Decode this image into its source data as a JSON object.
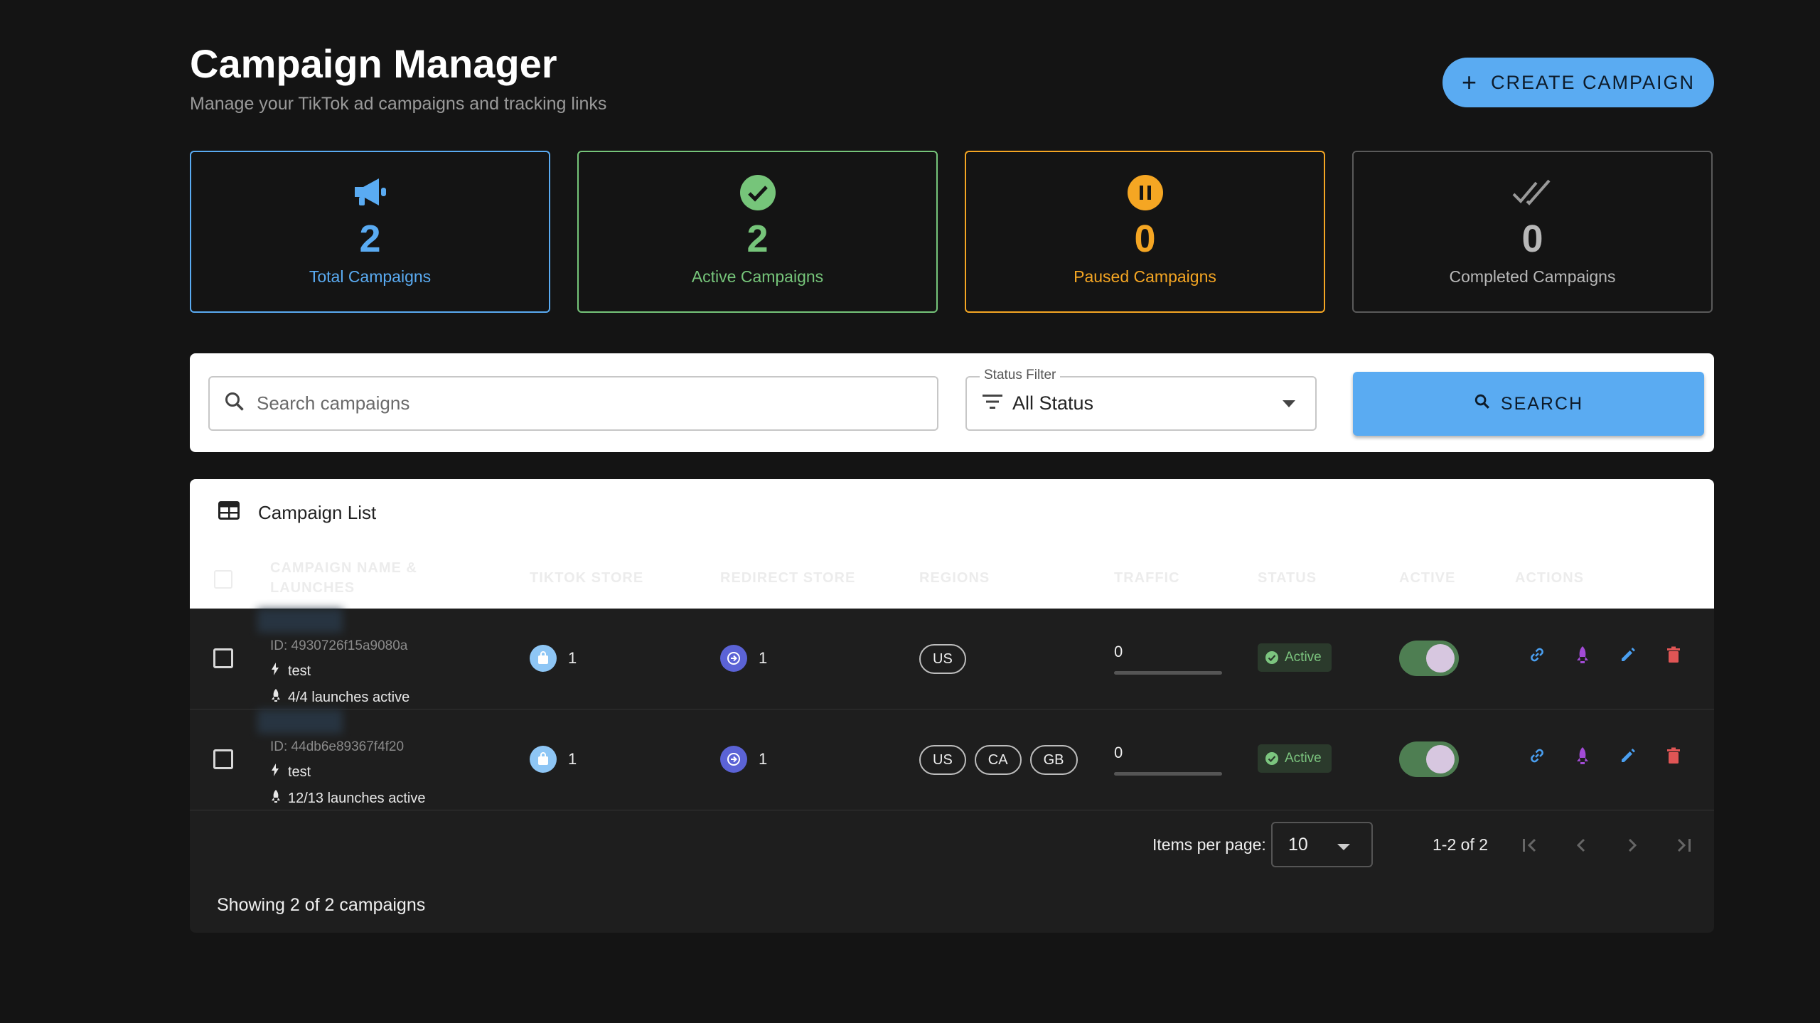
{
  "header": {
    "title": "Campaign Manager",
    "subtitle": "Manage your TikTok ad campaigns and tracking links",
    "create_button": "CREATE CAMPAIGN"
  },
  "stats": {
    "total": {
      "value": "2",
      "label": "Total Campaigns",
      "icon": "megaphone-icon",
      "color": "#5aabf2"
    },
    "active": {
      "value": "2",
      "label": "Active Campaigns",
      "icon": "check-circle-icon",
      "color": "#76c57a"
    },
    "paused": {
      "value": "0",
      "label": "Paused Campaigns",
      "icon": "pause-circle-icon",
      "color": "#f5a623"
    },
    "completed": {
      "value": "0",
      "label": "Completed Campaigns",
      "icon": "double-check-icon",
      "color": "#b8b8b8"
    }
  },
  "filters": {
    "search_placeholder": "Search campaigns",
    "status_label": "Status Filter",
    "status_value": "All Status",
    "search_button": "SEARCH"
  },
  "list": {
    "title": "Campaign List",
    "columns": [
      "CAMPAIGN NAME &",
      "LAUNCHES",
      "TIKTOK STORE",
      "REDIRECT STORE",
      "REGIONS",
      "TRAFFIC",
      "STATUS",
      "ACTIVE",
      "ACTIONS"
    ],
    "rows": [
      {
        "id": "ID: 4930726f15a9080a",
        "tag": "test",
        "launches": "4/4 launches active",
        "tiktok_store": "1",
        "redirect_store": "1",
        "regions": [
          "US"
        ],
        "traffic": "0",
        "traffic_fraction": 0,
        "status": "Active",
        "active": true
      },
      {
        "id": "ID: 44db6e89367f4f20",
        "tag": "test",
        "launches": "12/13 launches active",
        "tiktok_store": "1",
        "redirect_store": "1",
        "regions": [
          "US",
          "CA",
          "GB"
        ],
        "traffic": "0",
        "traffic_fraction": 0,
        "status": "Active",
        "active": true
      }
    ],
    "pagination": {
      "items_per_page_label": "Items per page:",
      "items_per_page": "10",
      "range": "1-2 of 2"
    },
    "showing": "Showing 2 of 2 campaigns"
  },
  "colors": {
    "accent": "#5aabf2",
    "success": "#76c57a",
    "warning": "#f5a623",
    "danger": "#e05555",
    "purple": "#a24bd6"
  }
}
